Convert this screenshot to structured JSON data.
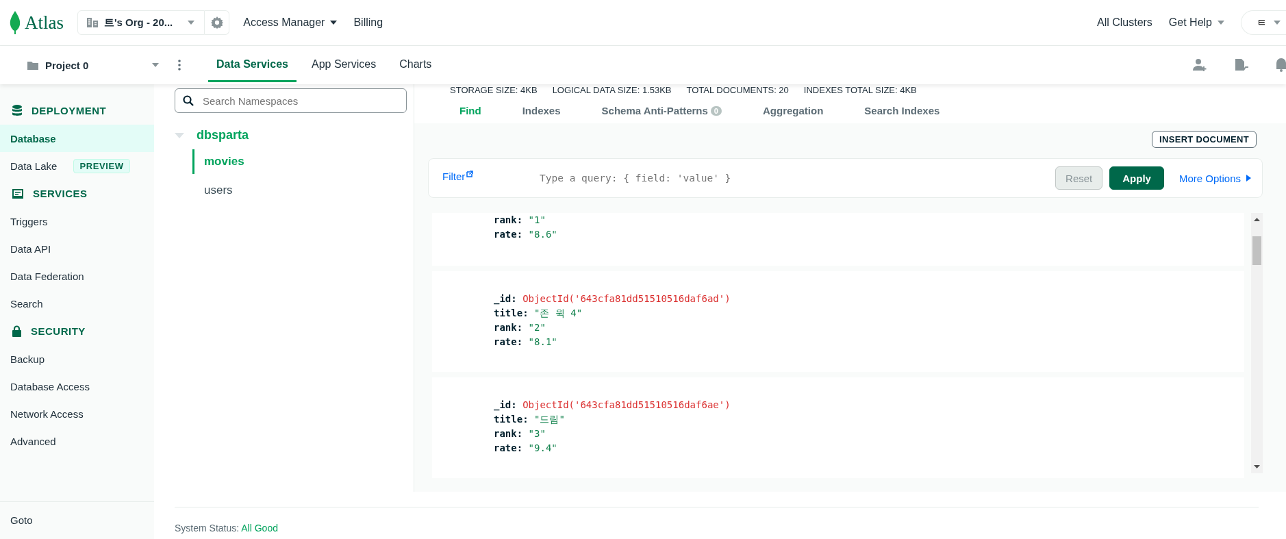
{
  "header": {
    "logo": "Atlas",
    "org_selector": "트's Org - 20...",
    "nav": [
      {
        "label": "Access Manager",
        "dropdown": true
      },
      {
        "label": "Billing",
        "dropdown": false
      }
    ],
    "right": [
      {
        "label": "All Clusters",
        "dropdown": false
      },
      {
        "label": "Get Help",
        "dropdown": true
      }
    ],
    "user_initial": "ㅌ"
  },
  "subheader": {
    "project": "Project 0",
    "tabs": [
      {
        "label": "Data Services",
        "selected": true
      },
      {
        "label": "App Services",
        "selected": false
      },
      {
        "label": "Charts",
        "selected": false
      }
    ]
  },
  "sidebar": {
    "sections": [
      {
        "title": "DEPLOYMENT",
        "items": [
          {
            "label": "Database",
            "selected": true
          },
          {
            "label": "Data Lake",
            "selected": false,
            "badge": "PREVIEW"
          }
        ]
      },
      {
        "title": "SERVICES",
        "items": [
          {
            "label": "Triggers",
            "selected": false
          },
          {
            "label": "Data API",
            "selected": false
          },
          {
            "label": "Data Federation",
            "selected": false
          },
          {
            "label": "Search",
            "selected": false
          }
        ]
      },
      {
        "title": "SECURITY",
        "items": [
          {
            "label": "Backup",
            "selected": false
          },
          {
            "label": "Database Access",
            "selected": false
          },
          {
            "label": "Network Access",
            "selected": false
          },
          {
            "label": "Advanced",
            "selected": false
          }
        ]
      }
    ],
    "footer_item": "Goto"
  },
  "namespaces": {
    "search_placeholder": "Search Namespaces",
    "databases": [
      {
        "name": "dbsparta",
        "expanded": true,
        "children": [
          {
            "name": "movies",
            "selected": true
          },
          {
            "name": "users",
            "selected": false
          }
        ]
      }
    ]
  },
  "stats": [
    "STORAGE SIZE: 4KB",
    "LOGICAL DATA SIZE: 1.53KB",
    "TOTAL DOCUMENTS: 20",
    "INDEXES TOTAL SIZE: 4KB"
  ],
  "tabs": [
    {
      "label": "Find",
      "selected": true
    },
    {
      "label": "Indexes",
      "selected": false
    },
    {
      "label": "Schema Anti-Patterns",
      "selected": false,
      "badge": "0"
    },
    {
      "label": "Aggregation",
      "selected": false
    },
    {
      "label": "Search Indexes",
      "selected": false
    }
  ],
  "insert_button": "INSERT DOCUMENT",
  "filter": {
    "label": "Filter",
    "placeholder": "Type a query: { field: 'value' }",
    "reset": "Reset",
    "apply": "Apply",
    "more": "More Options"
  },
  "documents": [
    {
      "fields": [
        {
          "key": "rank:",
          "value": "\"1\"",
          "kind": "string"
        },
        {
          "key": "rate:",
          "value": "\"8.6\"",
          "kind": "string"
        }
      ]
    },
    {
      "fields": [
        {
          "key": "_id:",
          "value": "ObjectId('643cfa81dd51510516daf6ad')",
          "kind": "objectid"
        },
        {
          "key": "title:",
          "value": "\"존 윅 4\"",
          "kind": "string"
        },
        {
          "key": "rank:",
          "value": "\"2\"",
          "kind": "string"
        },
        {
          "key": "rate:",
          "value": "\"8.1\"",
          "kind": "string"
        }
      ]
    },
    {
      "fields": [
        {
          "key": "_id:",
          "value": "ObjectId('643cfa81dd51510516daf6ae')",
          "kind": "objectid"
        },
        {
          "key": "title:",
          "value": "\"드림\"",
          "kind": "string"
        },
        {
          "key": "rank:",
          "value": "\"3\"",
          "kind": "string"
        },
        {
          "key": "rate:",
          "value": "\"9.4\"",
          "kind": "string"
        }
      ]
    }
  ],
  "status": {
    "label": "System Status:",
    "value": "All Good"
  }
}
